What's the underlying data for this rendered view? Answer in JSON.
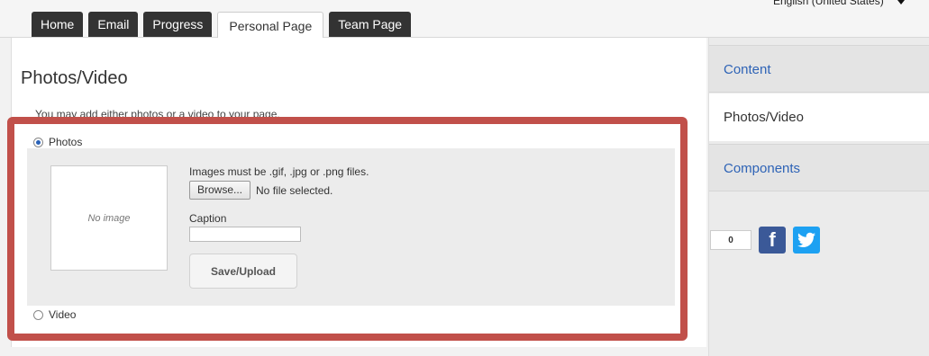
{
  "tabs": [
    {
      "label": "Home"
    },
    {
      "label": "Email"
    },
    {
      "label": "Progress"
    },
    {
      "label": "Personal Page",
      "active": true
    },
    {
      "label": "Team Page"
    }
  ],
  "language": {
    "selected": "English (United States)"
  },
  "main": {
    "title": "Photos/Video",
    "intro": "You may add either photos or a video to your page.",
    "photos_option": {
      "label": "Photos",
      "checked": true
    },
    "video_option": {
      "label": "Video",
      "checked": false
    },
    "upload": {
      "no_image_text": "No image",
      "file_types_note": "Images must be .gif, .jpg or .png files.",
      "browse_label": "Browse...",
      "file_status": "No file selected.",
      "caption_label": "Caption",
      "caption_value": "",
      "save_label": "Save/Upload"
    }
  },
  "sidebar": {
    "items": [
      {
        "label": "Content"
      },
      {
        "label": "Photos/Video"
      },
      {
        "label": "Components"
      }
    ]
  },
  "share": {
    "count": "0"
  },
  "colors": {
    "highlight_border": "#c1504a",
    "link": "#2e63b6",
    "tab_dark": "#333333"
  }
}
